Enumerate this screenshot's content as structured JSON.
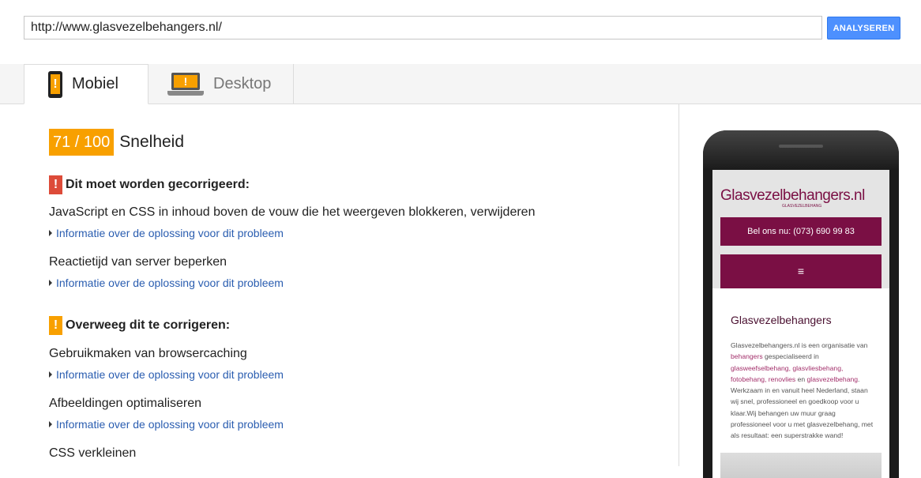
{
  "search": {
    "url_value": "http://www.glasvezelbehangers.nl/",
    "analyze_label": "ANALYSEREN"
  },
  "tabs": [
    {
      "label": "Mobiel",
      "active": true
    },
    {
      "label": "Desktop",
      "active": false
    }
  ],
  "score": {
    "value": "71 / 100",
    "label": "Snelheid",
    "color": "#f8a000"
  },
  "sections": {
    "must_fix": {
      "icon": "!",
      "title": "Dit moet worden gecorrigeerd:",
      "color": "#dd4b39",
      "items": [
        {
          "rule": "JavaScript en CSS in inhoud boven de vouw die het weergeven blokkeren, verwijderen",
          "link": "Informatie over de oplossing voor dit probleem"
        },
        {
          "rule": "Reactietijd van server beperken",
          "link": "Informatie over de oplossing voor dit probleem"
        }
      ]
    },
    "consider_fix": {
      "icon": "!",
      "title": "Overweeg dit te corrigeren:",
      "color": "#f8a000",
      "items": [
        {
          "rule": "Gebruikmaken van browsercaching",
          "link": "Informatie over de oplossing voor dit probleem"
        },
        {
          "rule": "Afbeeldingen optimaliseren",
          "link": "Informatie over de oplossing voor dit probleem"
        },
        {
          "rule": "CSS verkleinen"
        }
      ]
    }
  },
  "preview": {
    "logo": "Glasvezelbehangers.nl",
    "logo_tag": "GLASVEZELBEHANG",
    "call": "Bel ons nu: (073) 690 99 83",
    "menu": "≡",
    "title": "Glasvezelbehangers",
    "text_parts": [
      "Glasvezelbehangers.nl is een organisatie van ",
      "behangers",
      " gespecialiseerd in ",
      "glasweefselbehang, glasvliesbehang, fotobehang, renovlies",
      " en ",
      "glasvezelbehang",
      ". Werkzaam in en vanuit heel Nederland, staan wij snel, professioneel en goedkoop voor u klaar.Wij behangen uw muur graag professioneel voor u met glasvezelbehang, met als resultaat: een superstrakke wand!"
    ],
    "accent_color": "#7a0f44"
  }
}
